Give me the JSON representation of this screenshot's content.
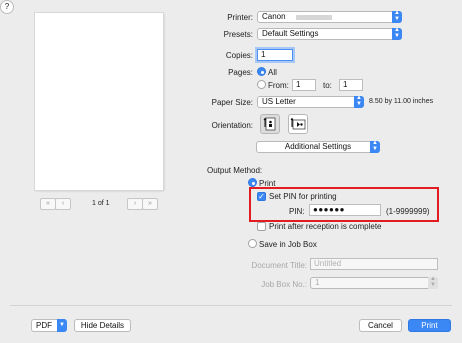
{
  "preview": {
    "first_label": "«",
    "prev_label": "‹",
    "next_label": "›",
    "last_label": "»",
    "page_indicator": "1 of 1"
  },
  "settings": {
    "printer_label": "Printer:",
    "printer_value": "Canon",
    "presets_label": "Presets:",
    "presets_value": "Default Settings",
    "copies_label": "Copies:",
    "copies_value": "1",
    "pages_label": "Pages:",
    "pages_all": "All",
    "pages_from": "From:",
    "pages_from_value": "1",
    "pages_to": "to:",
    "pages_to_value": "1",
    "paper_size_label": "Paper Size:",
    "paper_size_value": "US Letter",
    "paper_dimensions": "8.50 by 11.00 inches",
    "orientation_label": "Orientation:",
    "section_select": "Additional Settings"
  },
  "output": {
    "method_label": "Output Method:",
    "print_option": "Print",
    "set_pin_label": "Set PIN for printing",
    "pin_label": "PIN:",
    "pin_value": "●●●●●●",
    "pin_range": "(1-9999999)",
    "print_after_label": "Print after reception is complete",
    "save_in_job_box": "Save in Job Box",
    "document_title_label": "Document Title:",
    "document_title_value": "Untitled",
    "job_box_no_label": "Job Box No.:",
    "job_box_no_value": "1"
  },
  "footer": {
    "help_label": "?",
    "pdf_label": "PDF",
    "hide_details_label": "Hide Details",
    "cancel_label": "Cancel",
    "print_label": "Print"
  },
  "colors": {
    "accent": "#3b88f4",
    "highlight": "#e31b23"
  }
}
